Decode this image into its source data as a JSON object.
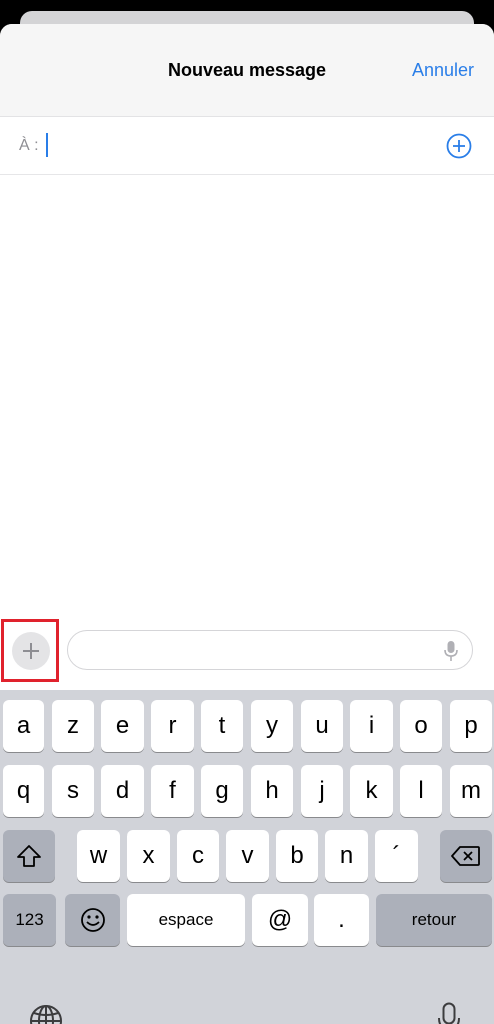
{
  "header": {
    "title": "Nouveau message",
    "cancel_label": "Annuler"
  },
  "to_field": {
    "label": "À :"
  },
  "keyboard": {
    "row1": [
      "a",
      "z",
      "e",
      "r",
      "t",
      "y",
      "u",
      "i",
      "o",
      "p"
    ],
    "row2": [
      "q",
      "s",
      "d",
      "f",
      "g",
      "h",
      "j",
      "k",
      "l",
      "m"
    ],
    "row3": [
      "w",
      "x",
      "c",
      "v",
      "b",
      "n",
      "´"
    ],
    "numbers_label": "123",
    "space_label": "espace",
    "at_label": "@",
    "period_label": ".",
    "return_label": "retour"
  },
  "colors": {
    "accent": "#2a7ee8",
    "highlight": "#e0222d"
  }
}
